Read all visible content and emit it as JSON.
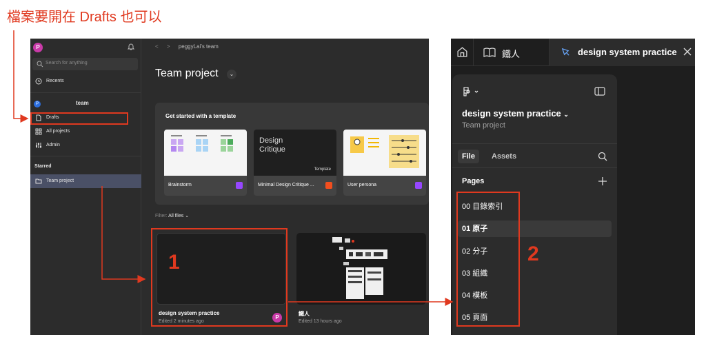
{
  "annotation": {
    "title": "檔案要開在 Drafts 也可以",
    "label_1": "1",
    "label_2": "2",
    "color": "#e0391f"
  },
  "left_window": {
    "sidebar": {
      "avatar_letter": "P",
      "search_placeholder": "Search for anything",
      "recents": "Recents",
      "team_avatar": "P",
      "team_name": "team",
      "drafts": "Drafts",
      "all_projects": "All projects",
      "admin": "Admin",
      "starred_heading": "Starred",
      "starred_item": "Team project"
    },
    "main": {
      "breadcrumb": "peggyLai's team",
      "title": "Team project",
      "templates_heading": "Get started with a template",
      "templates": [
        {
          "name": "Brainstorm",
          "badge_color": "#9747ff"
        },
        {
          "name": "Minimal Design Critique ...",
          "badge_color": "#f24e1e",
          "thumb_title": "Design Critique",
          "thumb_tag": "Template"
        },
        {
          "name": "User persona",
          "badge_color": "#9747ff"
        }
      ],
      "filter_label": "Filter:",
      "filter_value": "All files",
      "files": [
        {
          "name": "design system practice",
          "edited": "Edited 2 minutes ago",
          "owner": "P"
        },
        {
          "name": "鐵人",
          "edited": "Edited 13 hours ago"
        }
      ]
    }
  },
  "right_window": {
    "tabs": [
      {
        "label": "鐵人",
        "icon": "book-icon"
      },
      {
        "label": "design system practice",
        "icon": "pen-icon",
        "active": true
      }
    ],
    "project_name": "design system practice",
    "project_sub": "Team project",
    "panel_tabs": {
      "file": "File",
      "assets": "Assets"
    },
    "pages_heading": "Pages",
    "pages": [
      {
        "label": "00 目錄索引"
      },
      {
        "label": "01 原子",
        "active": true
      },
      {
        "label": "02 分子"
      },
      {
        "label": "03 組織"
      },
      {
        "label": "04 模板"
      },
      {
        "label": "05 頁面"
      }
    ]
  }
}
